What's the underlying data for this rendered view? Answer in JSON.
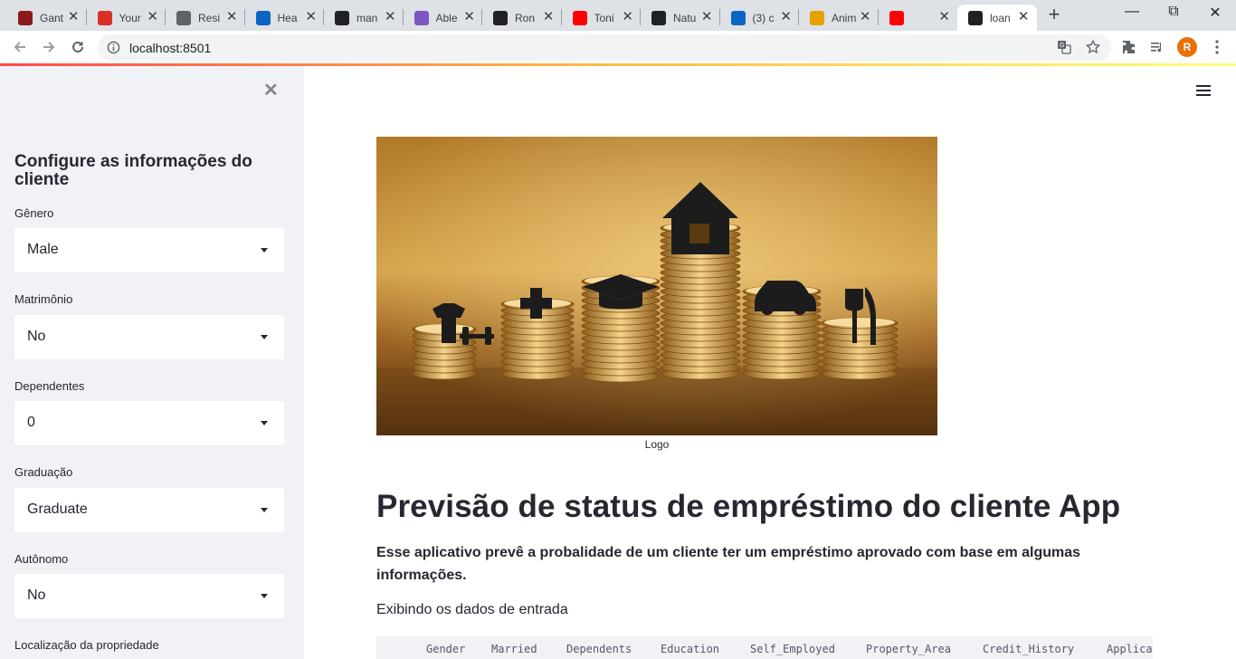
{
  "browser": {
    "tabs": [
      {
        "title": "Gant",
        "icon": "gantt-icon",
        "color": "#8b1a1a"
      },
      {
        "title": "Your",
        "icon": "crown-icon",
        "color": "#d93025"
      },
      {
        "title": "Resi",
        "icon": "phone-icon",
        "color": "#5f6368"
      },
      {
        "title": "Hea",
        "icon": "k-logo-icon",
        "color": "#0a66c2"
      },
      {
        "title": "man",
        "icon": "github-icon",
        "color": "#202124"
      },
      {
        "title": "Able",
        "icon": "a-logo-icon",
        "color": "#7e57c2"
      },
      {
        "title": "Ron",
        "icon": "github-icon",
        "color": "#202124"
      },
      {
        "title": "Toni",
        "icon": "youtube-icon",
        "color": "#ff0000"
      },
      {
        "title": "Natu",
        "icon": "github-icon",
        "color": "#202124"
      },
      {
        "title": "(3) c",
        "icon": "linkedin-icon",
        "color": "#0a66c2"
      },
      {
        "title": "Anim",
        "icon": "fw-logo-icon",
        "color": "#e6a100"
      },
      {
        "title": "",
        "icon": "youtube-icon",
        "color": "#ff0000"
      },
      {
        "title": "loan",
        "icon": "streamlit-icon",
        "color": "#202124"
      }
    ],
    "url": "localhost:8501",
    "profile_initial": "R"
  },
  "sidebar": {
    "title": "Configure as informações do cliente",
    "fields": [
      {
        "label": "Gênero",
        "value": "Male"
      },
      {
        "label": "Matrimônio",
        "value": "No"
      },
      {
        "label": "Dependentes",
        "value": "0"
      },
      {
        "label": "Graduação",
        "value": "Graduate"
      },
      {
        "label": "Autônomo",
        "value": "No"
      },
      {
        "label": "Localização da propriedade",
        "value": ""
      }
    ]
  },
  "main": {
    "image_caption": "Logo",
    "title": "Previsão de status de empréstimo do cliente App",
    "description": "Esse aplicativo prevê a probalidade de um cliente ter um empréstimo aprovado com base em algumas informações.",
    "input_heading": "Exibindo os dados de entrada",
    "table_columns": [
      "Gender",
      "Married",
      "Dependents",
      "Education",
      "Self_Employed",
      "Property_Area",
      "Credit_History",
      "Applica"
    ]
  },
  "colors": {
    "sidebar_bg": "#f0f2f6",
    "text": "#262730",
    "accent_gradient_start": "#ff4b4b",
    "accent_gradient_end": "#fffd80"
  }
}
